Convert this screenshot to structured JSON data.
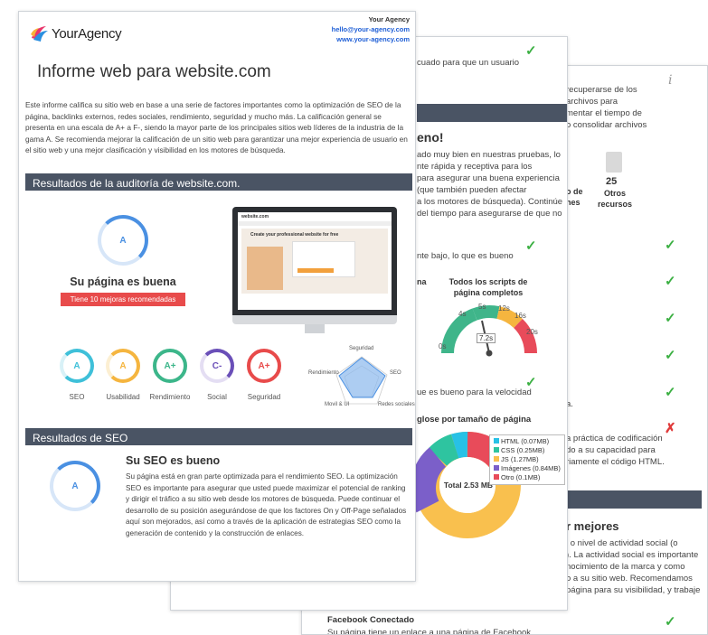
{
  "page3": {
    "info_icon": "info-icon",
    "intro_text": [
      "recuperarse de los",
      "archivos para",
      "mentar el tiempo de",
      "o consolidar archivos"
    ],
    "resources": [
      {
        "value": "",
        "label": [
          "o de",
          "nes"
        ]
      },
      {
        "value": "25",
        "label": [
          "Otros",
          "recursos"
        ]
      }
    ],
    "snippet_a": "a.",
    "snippet_b": [
      "a práctica de codificación",
      "do a su capacidad para",
      "riamente el código HTML."
    ],
    "heading": "r mejores",
    "body": [
      "l o nivel de actividad social (o",
      "). La actividad social es importante",
      "nocimiento de la marca y como",
      "o a su sitio web. Recomendamos",
      "página para su visibilidad, y trabaje"
    ],
    "facebook_title": "Facebook Conectado",
    "facebook_desc": "Su página tiene un enlace a una página de Facebook."
  },
  "page2": {
    "top_text": [
      "cuado para que un usuario"
    ],
    "heading": "eno!",
    "body": [
      "ado muy bien en nuestras pruebas, lo",
      "nte rápida y receptiva para los",
      "para asegurar una buena experiencia",
      "(que también pueden afectar",
      "a los motores de búsqueda). Continúe",
      "del tiempo para asegurarse de que no"
    ],
    "low_text": "nte bajo, lo que es bueno",
    "left_label": "na",
    "gauge_title": "Todos los scripts de página completos",
    "gauge_ticks": [
      "0s",
      "4s",
      "5s",
      "12s",
      "16s",
      "20s"
    ],
    "gauge_value": "7.2s",
    "speed_text": "ue es bueno para la velocidad",
    "donut_title": "glose por tamaño de página",
    "donut_center": "Total 2.53 MB",
    "legend": [
      {
        "label": "HTML (0.07MB)",
        "color": "#27c1e6"
      },
      {
        "label": "CSS (0.25MB)",
        "color": "#2ec4a0"
      },
      {
        "label": "JS (1.27MB)",
        "color": "#f9c04e"
      },
      {
        "label": "Imágenes (0.84MB)",
        "color": "#7b5fc9"
      },
      {
        "label": "Otro (0.1MB)",
        "color": "#e84b5a"
      }
    ]
  },
  "page1": {
    "brand": "YourAgency",
    "contact": {
      "name": "Your Agency",
      "email": "hello@your-agency.com",
      "website": "www.your-agency.com"
    },
    "title": "Informe web para website.com",
    "intro": "Este informe califica su sitio web en base a una serie de factores importantes como la optimización de SEO de la página, backlinks externos, redes sociales, rendimiento, seguridad y mucho más. La calificación general se presenta en una escala de A+ a F-, siendo la mayor parte de los principales sitios web líderes de la industria de la gama A. Se recomienda mejorar la calificación de un sitio web para garantizar una mejor experiencia de usuario en el sitio web y una mejor clasificación y visibilidad en los motores de búsqueda.",
    "audit_bar": "Resultados de la auditoría de website.com.",
    "overall_grade": "A",
    "overall_heading": "Su página es buena",
    "improvements_badge": "Tiene 10 mejoras recomendadas",
    "monitor": {
      "site": "website.com",
      "headline": "Create your professional website for free"
    },
    "scores": [
      {
        "grade": "A",
        "label": "SEO",
        "color": "#3fc0d9"
      },
      {
        "grade": "A",
        "label": "Usabilidad",
        "color": "#f5b53f"
      },
      {
        "grade": "A+",
        "label": "Rendimiento",
        "color": "#3cb68a"
      },
      {
        "grade": "C-",
        "label": "Social",
        "color": "#6a4fb8"
      },
      {
        "grade": "A+",
        "label": "Seguridad",
        "color": "#e84b4b"
      }
    ],
    "radar_labels": [
      "Seguridad",
      "SEO",
      "Redes sociales",
      "Movil & UI",
      "Rendimiento"
    ],
    "seo_bar": "Resultados de SEO",
    "seo_grade": "A",
    "seo_heading": "Su SEO es bueno",
    "seo_body": "Su página está en gran parte optimizada para el rendimiento SEO. La optimización SEO es importante para asegurar que usted puede maximizar el potencial de ranking y dirigir el tráfico a su sitio web desde los motores de búsqueda. Puede continuar el desarrollo de su posición asegurándose de que los factores On y Off-Page señalados aquí son mejorados, así como a través de la aplicación de estrategias SEO como la generación de contenido y la construcción de enlaces."
  }
}
